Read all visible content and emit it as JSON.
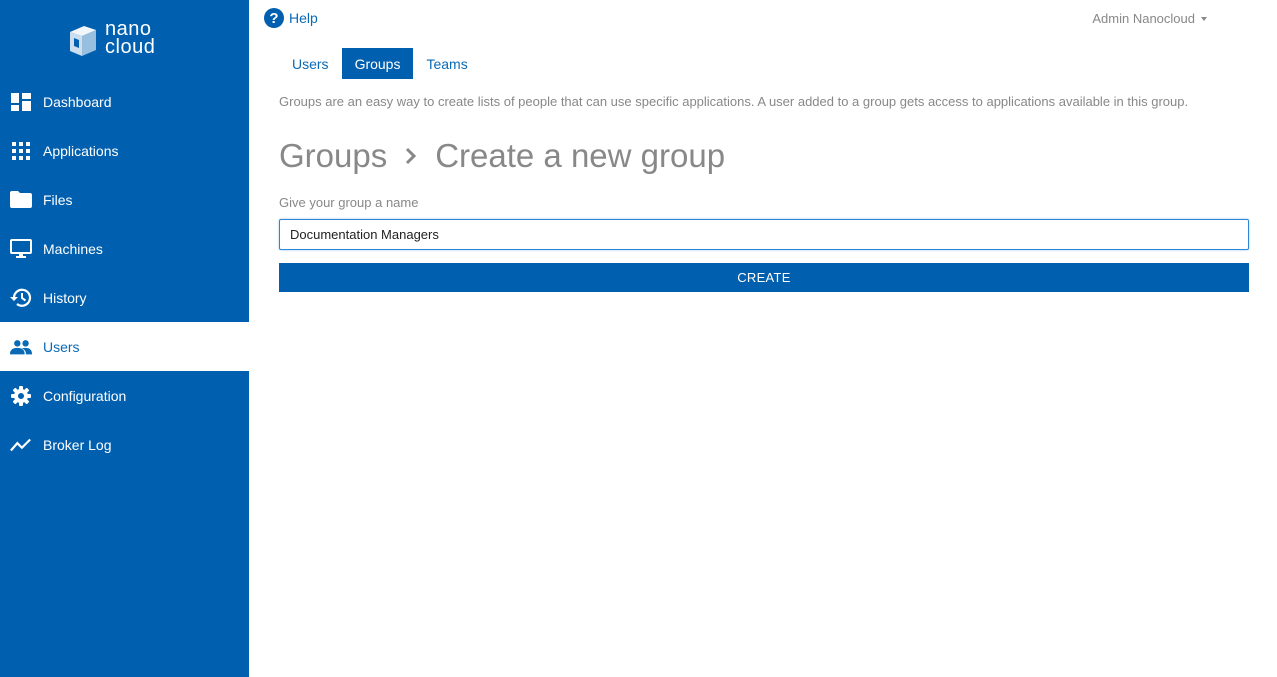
{
  "brand": {
    "line1": "nano",
    "line2": "cloud"
  },
  "colors": {
    "sidebar": "#005fae",
    "accent": "#0a6ab6",
    "muted": "#888888"
  },
  "sidebar": {
    "items": [
      {
        "label": "Dashboard",
        "icon": "dashboard-icon"
      },
      {
        "label": "Applications",
        "icon": "apps-grid-icon"
      },
      {
        "label": "Files",
        "icon": "folder-icon"
      },
      {
        "label": "Machines",
        "icon": "monitor-icon"
      },
      {
        "label": "History",
        "icon": "history-icon"
      },
      {
        "label": "Users",
        "icon": "users-icon",
        "active": true
      },
      {
        "label": "Configuration",
        "icon": "gear-icon"
      },
      {
        "label": "Broker Log",
        "icon": "activity-icon"
      }
    ]
  },
  "topbar": {
    "help_label": "Help",
    "help_icon": "?",
    "user_name": "Admin Nanocloud"
  },
  "tabs": [
    {
      "label": "Users",
      "active": false
    },
    {
      "label": "Groups",
      "active": true
    },
    {
      "label": "Teams",
      "active": false
    }
  ],
  "description": "Groups are an easy way to create lists of people that can use specific applications. A user added to a group gets access to applications available in this group.",
  "breadcrumb": {
    "parent": "Groups",
    "current": "Create a new group"
  },
  "form": {
    "name_label": "Give your group a name",
    "name_value": "Documentation Managers",
    "create_label": "CREATE"
  }
}
